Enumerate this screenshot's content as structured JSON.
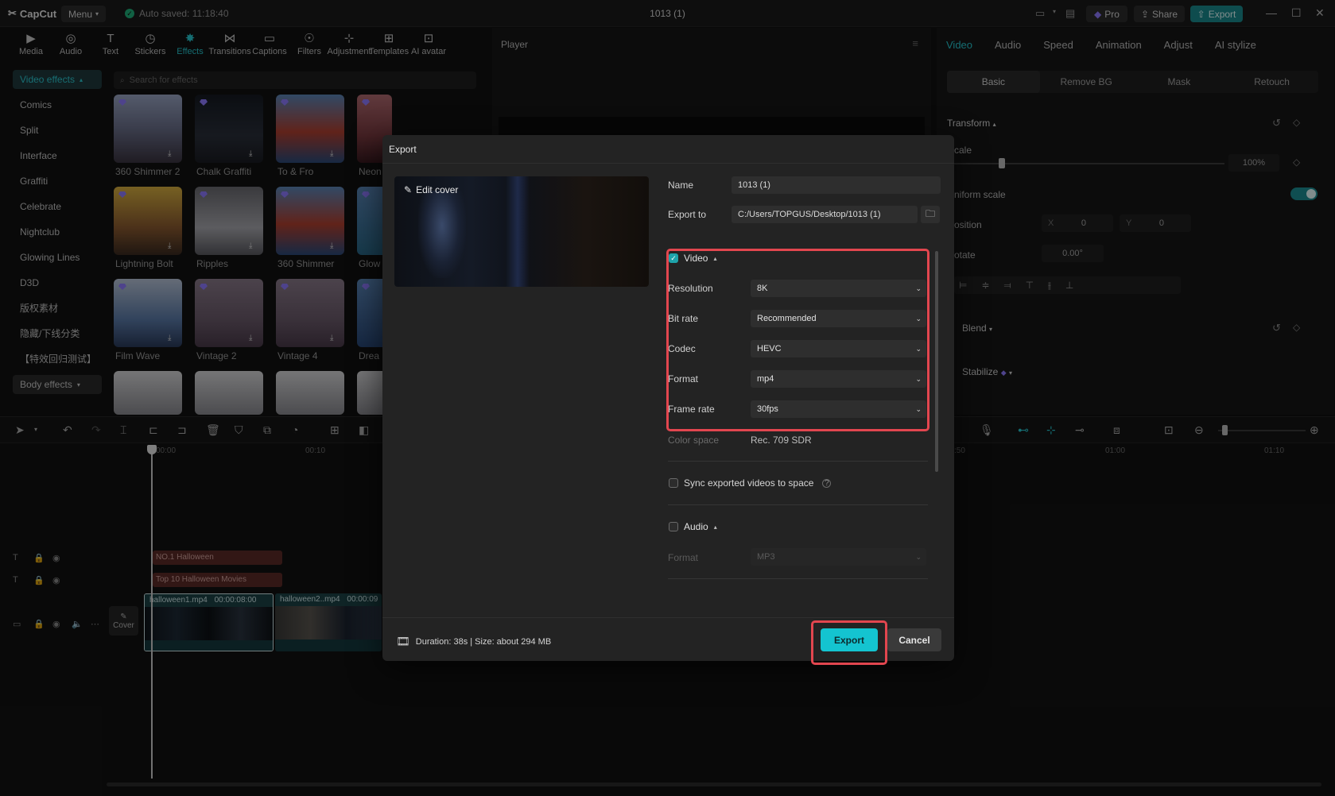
{
  "titlebar": {
    "app_name": "CapCut",
    "menu_label": "Menu",
    "autosave": "Auto saved: 11:18:40",
    "project_title": "1013 (1)",
    "pro_label": "Pro",
    "share_label": "Share",
    "export_label": "Export"
  },
  "tools": [
    "Media",
    "Audio",
    "Text",
    "Stickers",
    "Effects",
    "Transitions",
    "Captions",
    "Filters",
    "Adjustment",
    "Templates",
    "AI avatar"
  ],
  "tool_icons": [
    "media-icon",
    "audio-icon",
    "text-icon",
    "stickers-icon",
    "effects-icon",
    "transitions-icon",
    "captions-icon",
    "filters-icon",
    "adjustment-icon",
    "templates-icon",
    "ai-avatar-icon"
  ],
  "active_tool": "Effects",
  "effects": {
    "category_pill": "Video effects",
    "categories": [
      "Comics",
      "Split",
      "Interface",
      "Graffiti",
      "Celebrate",
      "Nightclub",
      "Glowing Lines",
      "D3D",
      "版权素材",
      "隐藏/下线分类",
      "【特效回归测试】"
    ],
    "body_effects": "Body effects",
    "search_placeholder": "Search for effects",
    "thumbs": [
      {
        "label": "360 Shimmer 2"
      },
      {
        "label": "Chalk Graffiti"
      },
      {
        "label": "To & Fro"
      },
      {
        "label": "Neon"
      },
      {
        "label": "Lightning Bolt"
      },
      {
        "label": "Ripples"
      },
      {
        "label": "360 Shimmer"
      },
      {
        "label": "Glow"
      },
      {
        "label": "Film Wave"
      },
      {
        "label": "Vintage 2"
      },
      {
        "label": "Vintage 4"
      },
      {
        "label": "Drea"
      }
    ]
  },
  "player": {
    "title": "Player"
  },
  "right_panel": {
    "tabs": [
      "Video",
      "Audio",
      "Speed",
      "Animation",
      "Adjust",
      "AI stylize"
    ],
    "subtabs": [
      "Basic",
      "Remove BG",
      "Mask",
      "Retouch"
    ],
    "transform": "Transform",
    "scale_label": "cale",
    "scale_value": "100%",
    "uniform_scale": "niform scale",
    "position_label": "osition",
    "pos_x_label": "X",
    "pos_x": "0",
    "pos_y_label": "Y",
    "pos_y": "0",
    "rotate_label": "otate",
    "rotate_value": "0.00°",
    "blend": "Blend",
    "stabilize": "Stabilize"
  },
  "timeline": {
    "ruler": [
      "00:00",
      "00:10",
      ":50",
      "01:00",
      "01:10"
    ],
    "text_clips": [
      "NO.1 Halloween",
      "Top 10 Halloween Movies"
    ],
    "cover_label": "Cover",
    "clip1": {
      "name": "halloween1.mp4",
      "duration": "00:00:08:00"
    },
    "clip2": {
      "name": "halloween2..mp4",
      "duration": "00:00:09"
    }
  },
  "export_dialog": {
    "title": "Export",
    "edit_cover": "Edit cover",
    "name_label": "Name",
    "name_value": "1013 (1)",
    "export_to_label": "Export to",
    "export_to_value": "C:/Users/TOPGUS/Desktop/1013 (1)",
    "video_section": "Video",
    "video_checked": true,
    "resolution_label": "Resolution",
    "resolution_value": "8K",
    "bitrate_label": "Bit rate",
    "bitrate_value": "Recommended",
    "codec_label": "Codec",
    "codec_value": "HEVC",
    "format_label": "Format",
    "format_value": "mp4",
    "framerate_label": "Frame rate",
    "framerate_value": "30fps",
    "colorspace_label": "Color space",
    "colorspace_value": "Rec. 709 SDR",
    "sync_label": "Sync exported videos to space",
    "sync_checked": false,
    "audio_section": "Audio",
    "audio_checked": false,
    "audio_format_label": "Format",
    "audio_format_value": "MP3",
    "footer_info": "Duration: 38s | Size: about 294 MB",
    "export_button": "Export",
    "cancel_button": "Cancel"
  },
  "colors": {
    "accent": "#27c7d0",
    "highlight": "#e2464f",
    "export_button": "#14c4d0"
  }
}
